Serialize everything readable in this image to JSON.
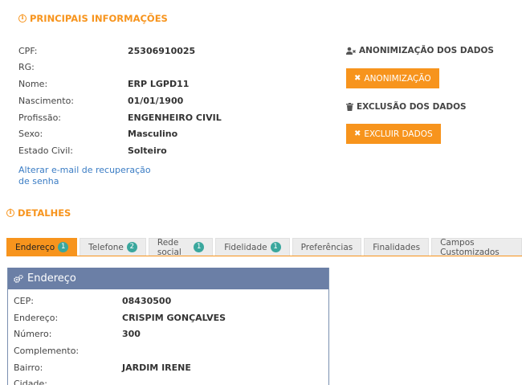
{
  "main_section": {
    "title": "PRINCIPAIS INFORMAÇÕES",
    "fields": [
      {
        "label": "CPF:",
        "value": "25306910025"
      },
      {
        "label": "RG:",
        "value": ""
      },
      {
        "label": "Nome:",
        "value": "ERP LGPD11"
      },
      {
        "label": "Nascimento:",
        "value": "01/01/1900"
      },
      {
        "label": "Profissão:",
        "value": "ENGENHEIRO CIVIL"
      },
      {
        "label": "Sexo:",
        "value": "Masculino"
      },
      {
        "label": "Estado Civil:",
        "value": "Solteiro"
      }
    ],
    "recovery_link": "Alterar e-mail de recuperação de senha"
  },
  "anonymization": {
    "heading": "ANONIMIZAÇÃO DOS DADOS",
    "button_label": "ANONIMIZAÇÃO"
  },
  "deletion": {
    "heading": "EXCLUSÃO DOS DADOS",
    "button_label": "EXCLUIR DADOS"
  },
  "details": {
    "title": "DETALHES",
    "tabs": [
      {
        "label": "Endereço",
        "badge": "1"
      },
      {
        "label": "Telefone",
        "badge": "2"
      },
      {
        "label": "Rede social",
        "badge": "1"
      },
      {
        "label": "Fidelidade",
        "badge": "1"
      },
      {
        "label": "Preferências",
        "badge": ""
      },
      {
        "label": "Finalidades",
        "badge": ""
      },
      {
        "label": "Campos Customizados",
        "badge": ""
      }
    ],
    "active_tab": "Endereço"
  },
  "address_panel": {
    "title": "Endereço",
    "fields": [
      {
        "label": "CEP:",
        "value": "08430500"
      },
      {
        "label": "Endereço:",
        "value": "CRISPIM GONÇALVES"
      },
      {
        "label": "Número:",
        "value": "300"
      },
      {
        "label": "Complemento:",
        "value": ""
      },
      {
        "label": "Bairro:",
        "value": "JARDIM IRENE"
      },
      {
        "label": "Cidade:",
        "value": ""
      }
    ]
  },
  "colors": {
    "accent": "#f7941d",
    "panel_header": "#6b7fa6",
    "badge": "#3aa79d",
    "link": "#3a7cc4"
  }
}
